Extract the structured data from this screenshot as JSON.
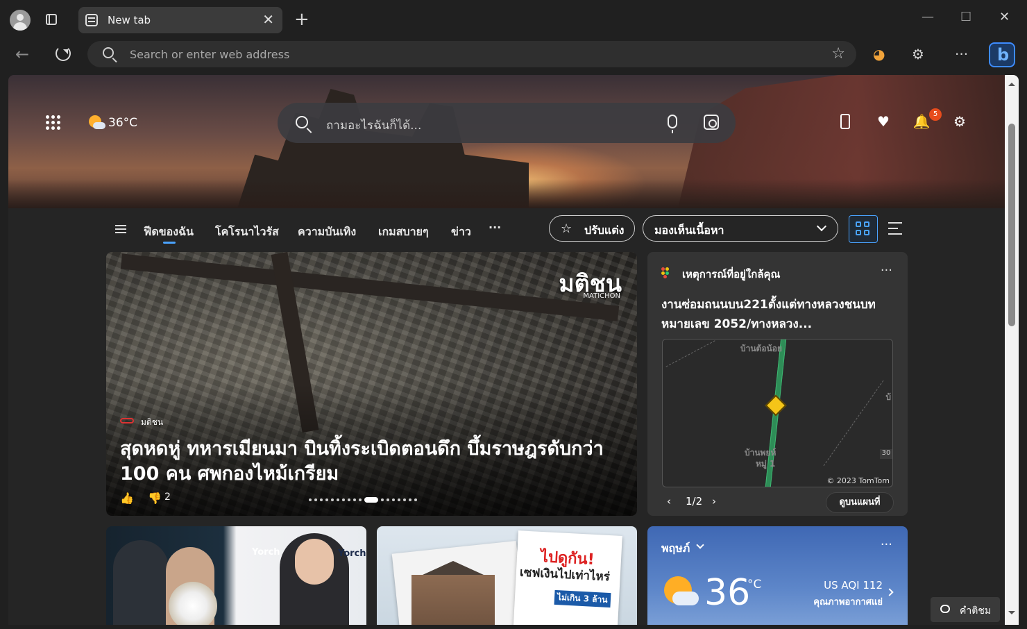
{
  "browser": {
    "tab_title": "New tab",
    "tab_close": "✕",
    "new_tab": "+",
    "window_controls": {
      "minimize": "—",
      "maximize": "☐",
      "close": "✕"
    },
    "address_placeholder": "Search or enter web address",
    "back_glyph": "←",
    "favorites_glyph": "☆",
    "extensions_glyph": "⚙",
    "menu_glyph": "···",
    "bing_glyph": "b"
  },
  "header": {
    "weather_temp": "36°C",
    "search_placeholder": "ถามอะไรฉันก็ได้...",
    "notification_count": "5",
    "rewards_glyph": "♥",
    "bell_glyph": "🔔",
    "settings_glyph": "⚙"
  },
  "nav": {
    "categories": [
      "ฟีดของฉัน",
      "โคโรนาไวรัส",
      "ความบันเทิง",
      "เกมสบายๆ",
      "ข่าว"
    ],
    "more": "···",
    "customize_label": "ปรับแต่ง",
    "content_visibility": "มองเห็นเนื้อหา"
  },
  "hero_card": {
    "logo": "มติชน",
    "logo_sub": "MATICHON",
    "source": "มติชน",
    "title": "สุดหดหู่ ทหารเมียนมา บินทิ้งระเบิดตอนดึก บึ้มราษฎรดับกว่า 100 คน ศพกองไหม้เกรียม",
    "likes_glyph": "👍",
    "dislikes_glyph": "👎",
    "dislikes": "2"
  },
  "traffic_card": {
    "header": "เหตุการณ์ที่อยู่ใกล้คุณ",
    "more": "···",
    "description": "งานซ่อมถนนบน221ตั้งแต่ทางหลวงชนบทหมายเลข 2052/ทางหลวง...",
    "map_labels": {
      "top": "บ้านต้อน้อย",
      "bottom1": "บ้านพยห์",
      "bottom2": "หมู่ 1",
      "right": "บ้",
      "road_num": "30",
      "copyright": "© 2023 TomTom"
    },
    "pager": "1/2",
    "pager_prev": "‹",
    "pager_next": "›",
    "map_button": "ดูบนแผนที่"
  },
  "kpop_card": {
    "brand1": "Yorch",
    "brand2": "Yorch"
  },
  "finance_card": {
    "headline": "ไปดูกัน!",
    "sub": "เซฟเงินไปเท่าไหร่",
    "tag": "ไม่เกิน 3 ล้าน"
  },
  "weather_card": {
    "location": "พฤษภ์",
    "more": "···",
    "temp": "36",
    "unit": "°C",
    "aqi": "US AQI 112",
    "aqi_desc": "คุณภาพอากาศแย่"
  },
  "feedback": {
    "label": "คำติชม"
  }
}
